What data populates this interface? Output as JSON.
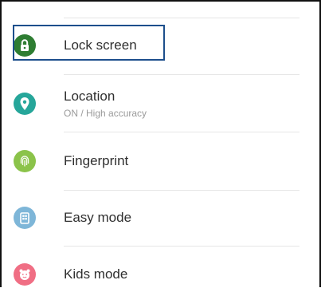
{
  "settings": {
    "items": [
      {
        "title": "Lock screen",
        "icon": "lock-screen-icon",
        "color": "#2E7D32",
        "focused": true
      },
      {
        "title": "Location",
        "subtitle": "ON / High accuracy",
        "icon": "location-pin-icon",
        "color": "#26A69A"
      },
      {
        "title": "Fingerprint",
        "icon": "fingerprint-icon",
        "color": "#8BC34A"
      },
      {
        "title": "Easy mode",
        "icon": "easy-mode-icon",
        "color": "#7EB6D8"
      },
      {
        "title": "Kids mode",
        "icon": "kids-mode-icon",
        "color": "#F06E84"
      }
    ]
  },
  "focus_outline_color": "#1D4F8C"
}
